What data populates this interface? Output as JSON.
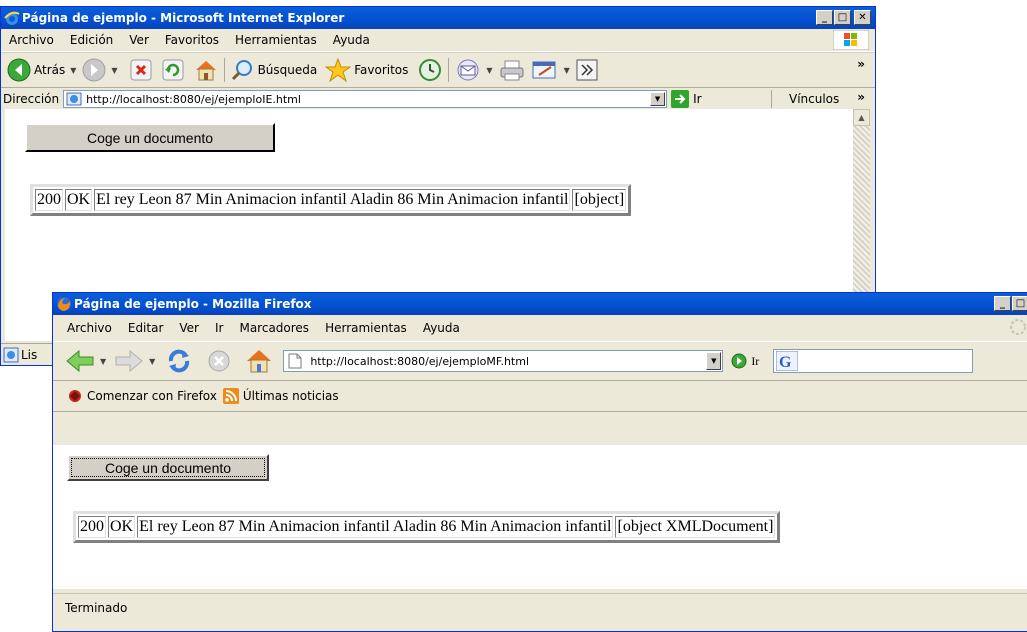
{
  "ie": {
    "title": "Página de ejemplo - Microsoft Internet Explorer",
    "menu": [
      "Archivo",
      "Edición",
      "Ver",
      "Favoritos",
      "Herramientas",
      "Ayuda"
    ],
    "toolbar": {
      "back": "Atrás",
      "search": "Búsqueda",
      "favorites": "Favoritos"
    },
    "address_label": "Dirección",
    "address_url": "http://localhost:8080/ej/ejemploIE.html",
    "go_label": "Ir",
    "links_label": "Vínculos",
    "status_text": "Lis",
    "page": {
      "button_label": "Coge un documento",
      "cells": [
        "200",
        "OK",
        "El rey Leon 87 Min Animacion infantil Aladin 86 Min Animacion infantil",
        "[object]"
      ]
    }
  },
  "ff": {
    "title": "Página de ejemplo - Mozilla Firefox",
    "menu": [
      "Archivo",
      "Editar",
      "Ver",
      "Ir",
      "Marcadores",
      "Herramientas",
      "Ayuda"
    ],
    "address_url": "http://localhost:8080/ej/ejemploMF.html",
    "go_label": "Ir",
    "bookmarks": [
      "Comenzar con Firefox",
      "Últimas noticias"
    ],
    "status_text": "Terminado",
    "page": {
      "button_label": "Coge un documento",
      "cells": [
        "200",
        "OK",
        "El rey Leon 87 Min Animacion infantil Aladin 86 Min Animacion infantil",
        "[object XMLDocument]"
      ]
    }
  }
}
